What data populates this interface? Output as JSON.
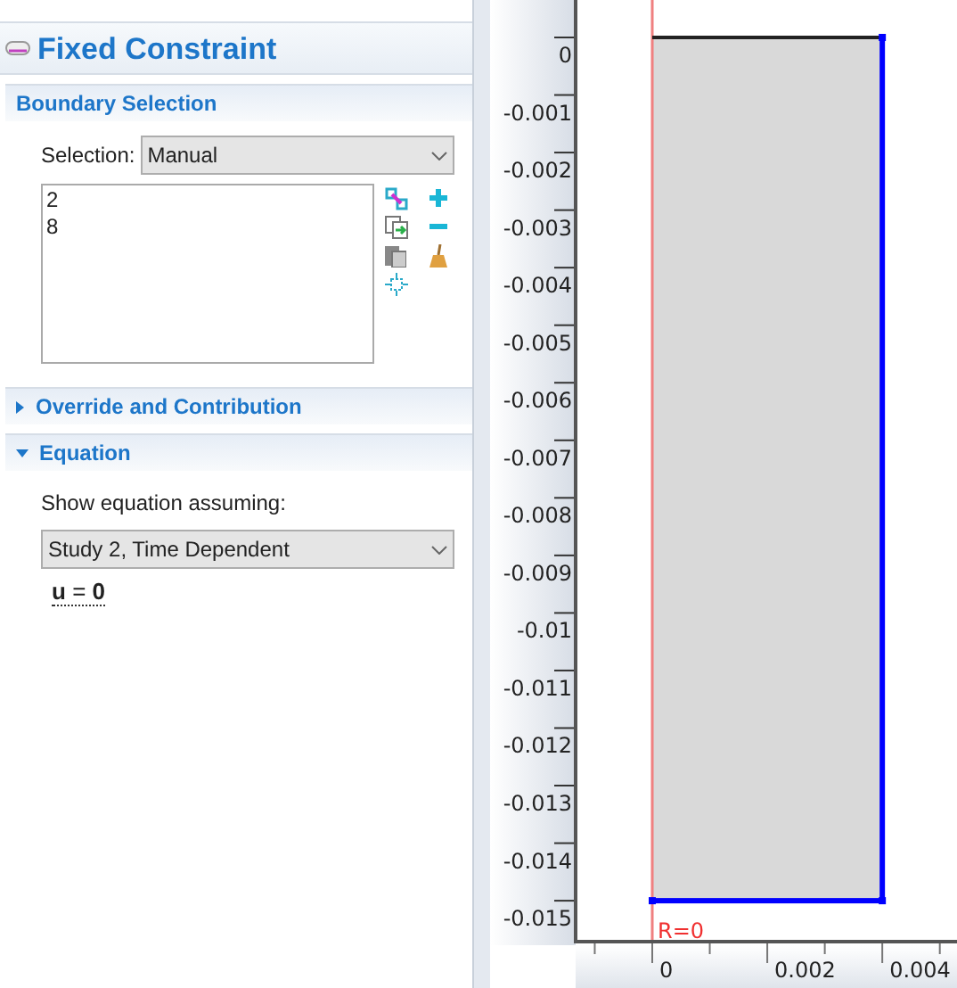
{
  "panel": {
    "title": "Fixed Constraint",
    "sections": [
      {
        "title": "Boundary Selection",
        "kind": "selection",
        "selection_label": "Selection:",
        "selection_value": "Manual",
        "items": [
          "2",
          "8"
        ]
      },
      {
        "title": "Override and Contribution",
        "kind": "empty",
        "expanded": false
      },
      {
        "title": "Equation",
        "kind": "equation",
        "expanded": true,
        "label": "Show equation assuming:",
        "study": "Study 2, Time Dependent",
        "equation": "**u** = **0**"
      }
    ]
  },
  "graphics": {
    "y_ticks": [
      "0",
      "-0.001",
      "-0.002",
      "-0.003",
      "-0.004",
      "-0.005",
      "-0.006",
      "-0.007",
      "-0.008",
      "-0.009",
      "-0.01",
      "-0.011",
      "-0.012",
      "-0.013",
      "-0.014",
      "-0.015"
    ],
    "x_ticks": [
      "0",
      "0.002",
      "0.004"
    ],
    "axis_label": "R=0",
    "boundaries": [
      {
        "selected": false
      },
      {
        "selected": true
      },
      {
        "selected": true
      }
    ]
  }
}
